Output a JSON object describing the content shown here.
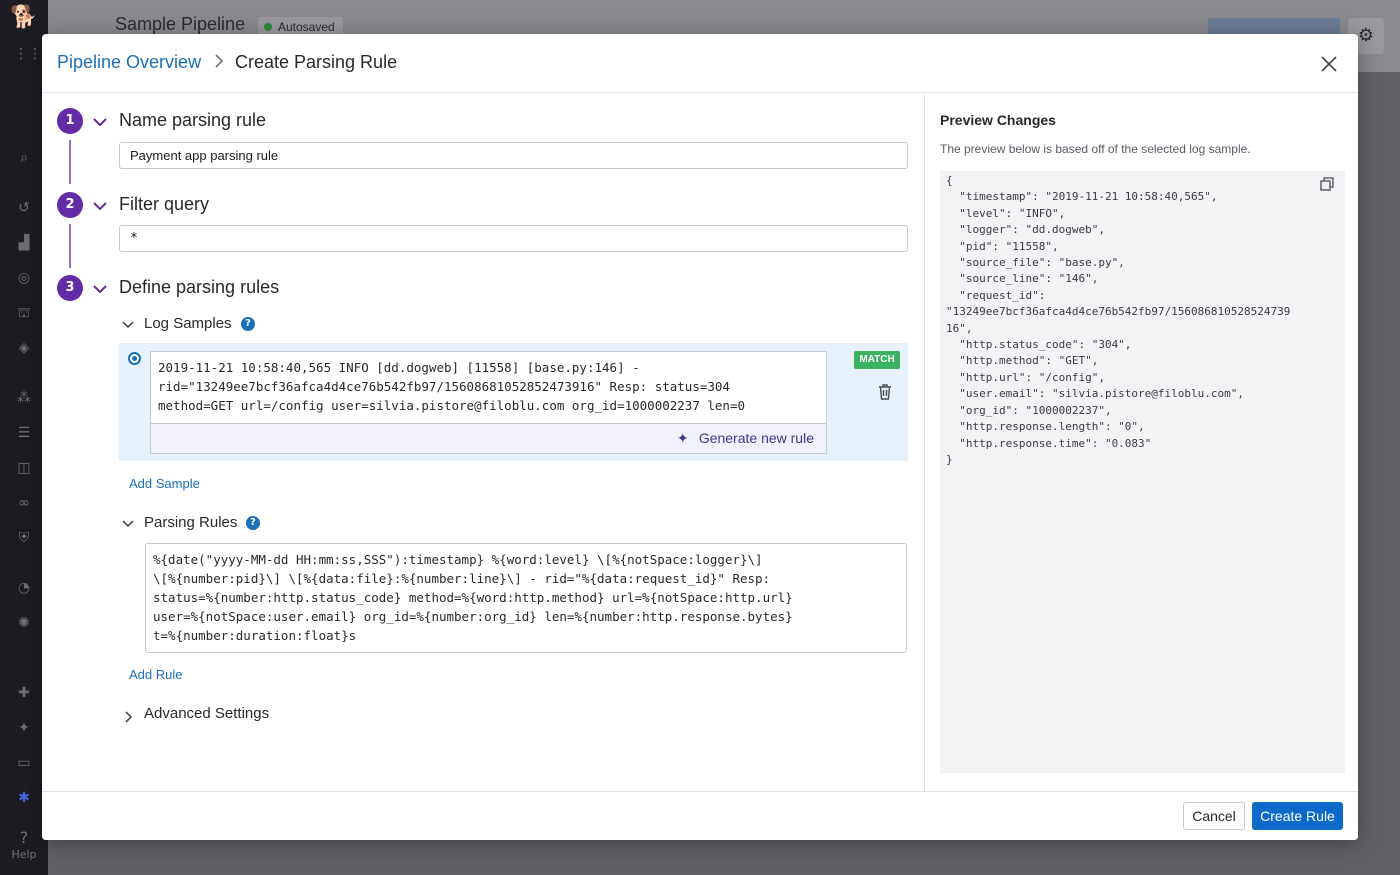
{
  "background": {
    "page_title": "Sample Pipeline",
    "autosave_status": "Autosaved",
    "help_label": "Help"
  },
  "breadcrumb": {
    "parent": "Pipeline Overview",
    "current": "Create Parsing Rule"
  },
  "steps": [
    {
      "number": "1",
      "title": "Name parsing rule"
    },
    {
      "number": "2",
      "title": "Filter query"
    },
    {
      "number": "3",
      "title": "Define parsing rules"
    }
  ],
  "name_rule": {
    "value": "Payment app parsing rule"
  },
  "filter_query": {
    "value": "*"
  },
  "log_samples": {
    "title": "Log Samples",
    "sample_text": "2019-11-21 10:58:40,565 INFO [dd.dogweb] [11558] [base.py:146] -\nrid=\"13249ee7bcf36afca4d4ce76b542fb97/15608681052852473916\" Resp: status=304\nmethod=GET url=/config user=silvia.pistore@filoblu.com org_id=1000002237 len=0",
    "match_badge": "MATCH",
    "generate_label": "Generate new rule",
    "add_sample": "Add Sample"
  },
  "parsing_rules": {
    "title": "Parsing Rules",
    "rule_text": "%{date(\"yyyy-MM-dd HH:mm:ss,SSS\"):timestamp} %{word:level} \\[%{notSpace:logger}\\]\n\\[%{number:pid}\\] \\[%{data:file}:%{number:line}\\] - rid=\"%{data:request_id}\" Resp:\nstatus=%{number:http.status_code} method=%{word:http.method} url=%{notSpace:http.url}\nuser=%{notSpace:user.email} org_id=%{number:org_id} len=%{number:http.response.bytes}\nt=%{number:duration:float}s",
    "add_rule": "Add Rule"
  },
  "advanced_settings": {
    "title": "Advanced Settings"
  },
  "preview": {
    "title": "Preview Changes",
    "description": "The preview below is based off of the selected log sample.",
    "json_text": "{\n  \"timestamp\": \"2019-11-21 10:58:40,565\",\n  \"level\": \"INFO\",\n  \"logger\": \"dd.dogweb\",\n  \"pid\": \"11558\",\n  \"source_file\": \"base.py\",\n  \"source_line\": \"146\",\n  \"request_id\":\n\"13249ee7bcf36afca4d4ce76b542fb97/156086810528524739\n16\",\n  \"http.status_code\": \"304\",\n  \"http.method\": \"GET\",\n  \"http.url\": \"/config\",\n  \"user.email\": \"silvia.pistore@filoblu.com\",\n  \"org_id\": \"1000002237\",\n  \"http.response.length\": \"0\",\n  \"http.response.time\": \"0.083\"\n}"
  },
  "footer": {
    "cancel": "Cancel",
    "create": "Create Rule"
  },
  "colors": {
    "step_accent": "#632ca6",
    "link": "#1b6fb8",
    "primary_button": "#0d6ac8",
    "match_badge": "#3bb161",
    "sample_highlight": "#e6f1fa"
  },
  "icons": {
    "help": "?",
    "sparkle": "✦"
  }
}
